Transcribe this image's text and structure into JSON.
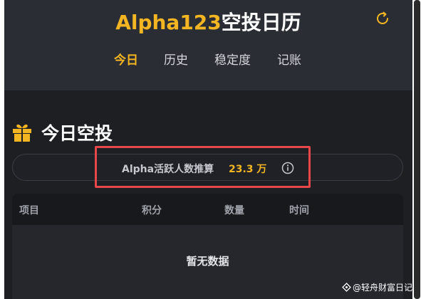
{
  "header": {
    "title_accent": "Alpha123",
    "title_rest": "空投日历",
    "refresh_icon": "refresh-icon",
    "accent_color": "#f3b521"
  },
  "nav": {
    "tabs": [
      {
        "label": "今日",
        "active": true
      },
      {
        "label": "历史",
        "active": false
      },
      {
        "label": "稳定度",
        "active": false
      },
      {
        "label": "记账",
        "active": false
      }
    ]
  },
  "section": {
    "icon": "gift-icon",
    "title": "今日空投"
  },
  "active_users": {
    "label": "Alpha活跃人数推算",
    "value": "23.3 万",
    "info_icon": "info-icon"
  },
  "table": {
    "columns": [
      "项目",
      "积分",
      "数量",
      "时间"
    ],
    "empty_text": "暂无数据"
  },
  "watermark": {
    "text": "@轻舟财富日记"
  }
}
